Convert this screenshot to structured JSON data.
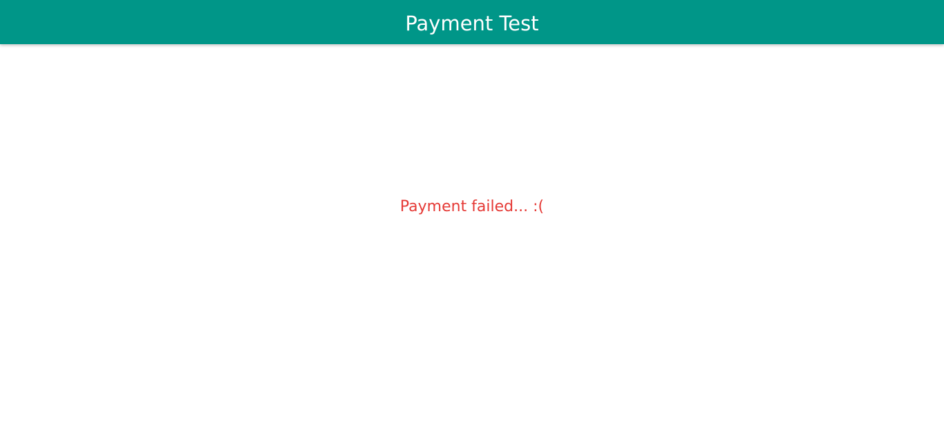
{
  "app_bar": {
    "title": "Payment Test",
    "background_color": "#009688",
    "title_color": "#FFFFFF"
  },
  "main": {
    "status_message": "Payment failed... :(",
    "status_color": "#E53935",
    "background_color": "#FFFFFF"
  }
}
